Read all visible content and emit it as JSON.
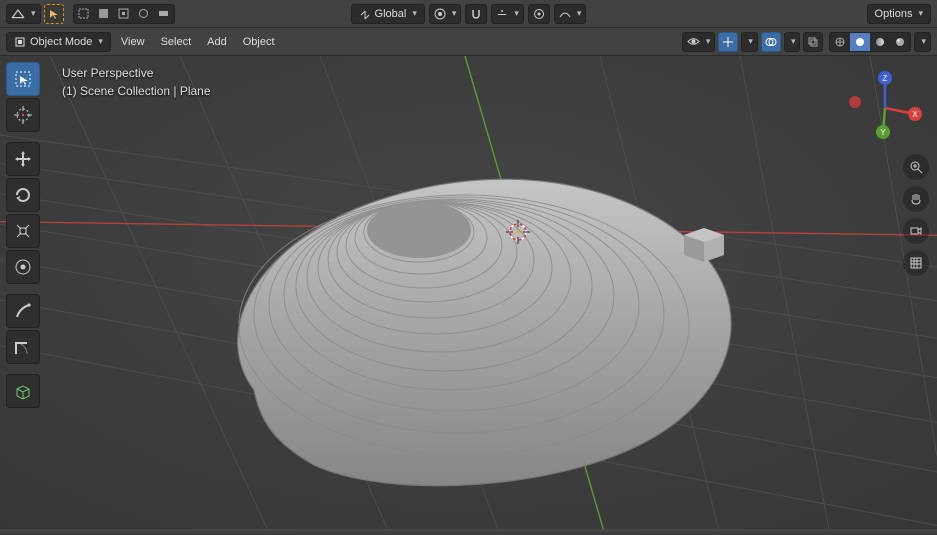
{
  "header": {
    "transform_orientation": "Global",
    "options_label": "Options"
  },
  "menubar": {
    "mode_label": "Object Mode",
    "items": [
      "View",
      "Select",
      "Add",
      "Object"
    ]
  },
  "overlay": {
    "line1": "User Perspective",
    "line2": "(1) Scene Collection | Plane"
  },
  "tools": [
    {
      "name": "select-box-tool",
      "active": true
    },
    {
      "name": "cursor-tool"
    },
    {
      "name": "move-tool"
    },
    {
      "name": "rotate-tool"
    },
    {
      "name": "scale-tool"
    },
    {
      "name": "transform-tool"
    },
    {
      "name": "annotate-tool"
    },
    {
      "name": "measure-tool"
    },
    {
      "name": "add-cube-tool"
    }
  ],
  "nav_icons": [
    {
      "name": "zoom-icon"
    },
    {
      "name": "pan-icon"
    },
    {
      "name": "camera-view-icon"
    },
    {
      "name": "perspective-toggle-icon"
    }
  ],
  "axes": {
    "x": "X",
    "y": "Y",
    "z": "Z"
  }
}
